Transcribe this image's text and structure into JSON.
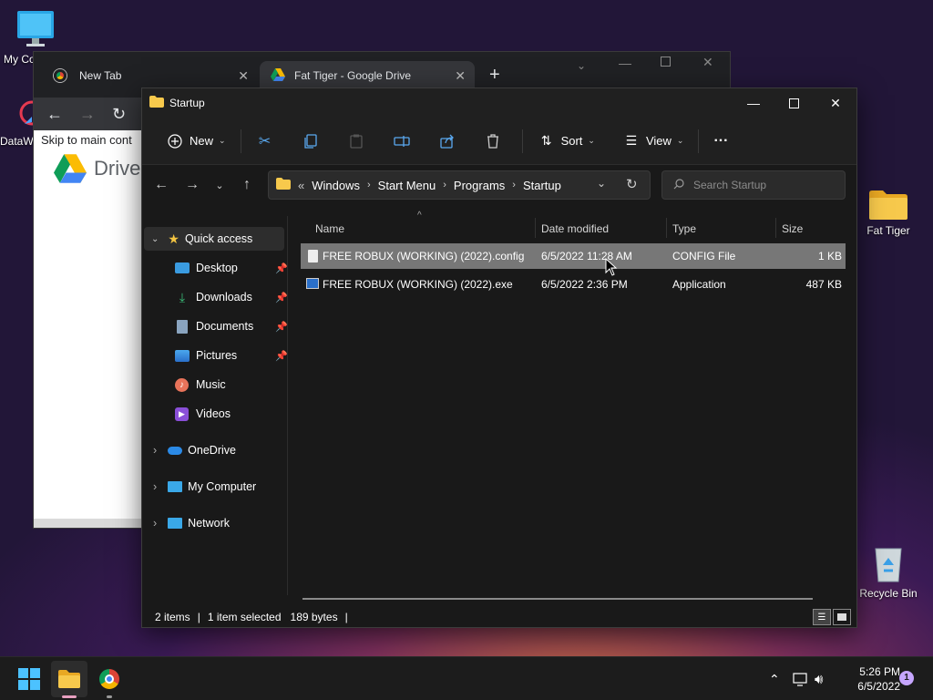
{
  "desktop": {
    "icons": [
      {
        "label": "My Co"
      },
      {
        "label": "DataW"
      },
      {
        "label": "Fat Tiger"
      },
      {
        "label": "Recycle Bin"
      }
    ]
  },
  "chrome": {
    "tabs": [
      {
        "label": "New Tab"
      },
      {
        "label": "Fat Tiger - Google Drive"
      }
    ],
    "skip_link": "Skip to main cont",
    "drive_logo_text": "Drive"
  },
  "explorer": {
    "title": "Startup",
    "commands": {
      "new": "New",
      "sort": "Sort",
      "view": "View",
      "more": "···"
    },
    "breadcrumb": {
      "overflow": "«",
      "items": [
        "Windows",
        "Start Menu",
        "Programs",
        "Startup"
      ]
    },
    "search_placeholder": "Search Startup",
    "nav": {
      "quick_access": "Quick access",
      "items": [
        {
          "label": "Desktop",
          "pinned": true
        },
        {
          "label": "Downloads",
          "pinned": true
        },
        {
          "label": "Documents",
          "pinned": true
        },
        {
          "label": "Pictures",
          "pinned": true
        },
        {
          "label": "Music",
          "pinned": false
        },
        {
          "label": "Videos",
          "pinned": false
        }
      ],
      "roots": [
        {
          "label": "OneDrive"
        },
        {
          "label": "My Computer"
        },
        {
          "label": "Network"
        }
      ]
    },
    "columns": {
      "name": "Name",
      "date": "Date modified",
      "type": "Type",
      "size": "Size"
    },
    "files": [
      {
        "name": "FREE ROBUX (WORKING) (2022).config",
        "date": "6/5/2022 11:28 AM",
        "type": "CONFIG File",
        "size": "1 KB",
        "selected": true
      },
      {
        "name": "FREE ROBUX (WORKING) (2022).exe",
        "date": "6/5/2022 2:36 PM",
        "type": "Application",
        "size": "487 KB",
        "selected": false
      }
    ],
    "status": {
      "count": "2 items",
      "selection": "1 item selected",
      "bytes": "189 bytes"
    }
  },
  "taskbar": {
    "time": "5:26 PM",
    "date": "6/5/2022",
    "notification_count": "1"
  },
  "colors": {
    "accent": "#0078d4",
    "selected_row": "#777777",
    "folder": "#f4c542"
  }
}
